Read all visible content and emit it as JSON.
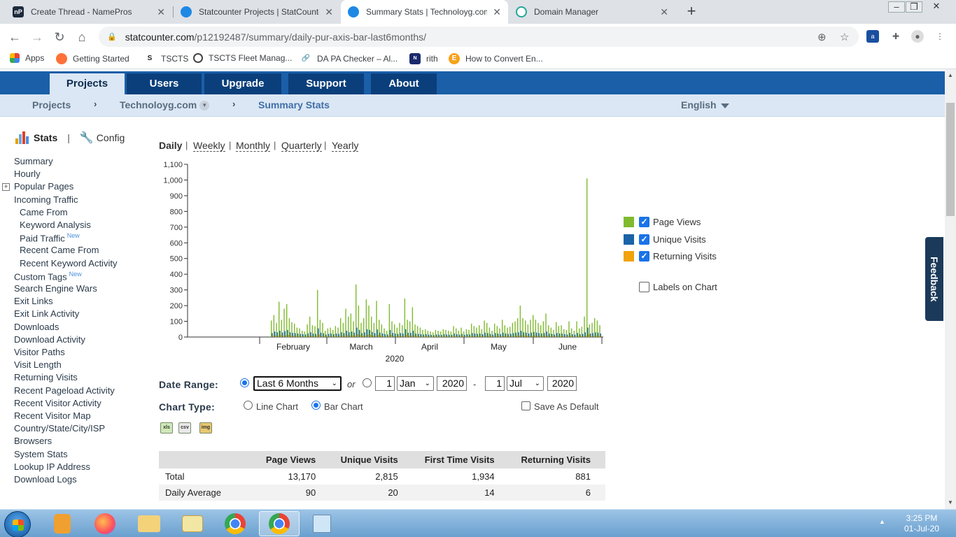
{
  "browser": {
    "tabs": [
      {
        "title": "Create Thread - NamePros",
        "favicon": "nP",
        "color": "#1c2a3c"
      },
      {
        "title": "Statcounter Projects | StatCounte",
        "favicon": "sc",
        "color": "#1e88e5"
      },
      {
        "title": "Summary Stats | Technoloyg.com",
        "favicon": "sc",
        "color": "#1e88e5"
      },
      {
        "title": "Domain Manager",
        "favicon": "dm",
        "color": "#26a69a"
      }
    ],
    "url_host": "statcounter.com",
    "url_path": "/p12192487/summary/daily-pur-axis-bar-last6months/",
    "bookmarks": [
      "Apps",
      "Getting Started",
      "TSCTS",
      "TSCTS Fleet Manag...",
      "DA PA Checker – Al...",
      "rith",
      "How to Convert En..."
    ]
  },
  "nav": {
    "tabs": [
      "Projects",
      "Users",
      "Upgrade",
      "Support",
      "About"
    ],
    "breadcrumb": [
      "Projects",
      "Technoloyg.com",
      "Summary Stats"
    ],
    "language": "English"
  },
  "sidebar": {
    "stats": "Stats",
    "config": "Config",
    "items": [
      {
        "label": "Summary",
        "indent": false,
        "tag": ""
      },
      {
        "label": "Hourly",
        "indent": false,
        "tag": ""
      },
      {
        "label": "Popular Pages",
        "indent": false,
        "tag": "",
        "expand": true
      },
      {
        "label": "Incoming Traffic",
        "indent": false,
        "tag": ""
      },
      {
        "label": "Came From",
        "indent": true,
        "tag": ""
      },
      {
        "label": "Keyword Analysis",
        "indent": true,
        "tag": ""
      },
      {
        "label": "Paid Traffic",
        "indent": true,
        "tag": "New"
      },
      {
        "label": "Recent Came From",
        "indent": true,
        "tag": ""
      },
      {
        "label": "Recent Keyword Activity",
        "indent": true,
        "tag": ""
      },
      {
        "label": "Custom Tags",
        "indent": false,
        "tag": "New"
      },
      {
        "label": "Search Engine Wars",
        "indent": false,
        "tag": ""
      },
      {
        "label": "Exit Links",
        "indent": false,
        "tag": ""
      },
      {
        "label": "Exit Link Activity",
        "indent": false,
        "tag": ""
      },
      {
        "label": "Downloads",
        "indent": false,
        "tag": ""
      },
      {
        "label": "Download Activity",
        "indent": false,
        "tag": ""
      },
      {
        "label": "Visitor Paths",
        "indent": false,
        "tag": ""
      },
      {
        "label": "Visit Length",
        "indent": false,
        "tag": ""
      },
      {
        "label": "Returning Visits",
        "indent": false,
        "tag": ""
      },
      {
        "label": "Recent Pageload Activity",
        "indent": false,
        "tag": ""
      },
      {
        "label": "Recent Visitor Activity",
        "indent": false,
        "tag": ""
      },
      {
        "label": "Recent Visitor Map",
        "indent": false,
        "tag": ""
      },
      {
        "label": "Country/State/City/ISP",
        "indent": false,
        "tag": ""
      },
      {
        "label": "Browsers",
        "indent": false,
        "tag": ""
      },
      {
        "label": "System Stats",
        "indent": false,
        "tag": ""
      },
      {
        "label": "Lookup IP Address",
        "indent": false,
        "tag": ""
      },
      {
        "label": "Download Logs",
        "indent": false,
        "tag": ""
      }
    ]
  },
  "periods": {
    "daily": "Daily",
    "weekly": "Weekly",
    "monthly": "Monthly",
    "quarterly": "Quarterly",
    "yearly": "Yearly"
  },
  "legend": {
    "page_views": "Page Views",
    "unique_visits": "Unique Visits",
    "returning_visits": "Returning Visits",
    "labels_on_chart": "Labels on Chart",
    "colors": {
      "page_views": "#7fba2f",
      "unique_visits": "#1a63a8",
      "returning_visits": "#f0a30a"
    }
  },
  "controls": {
    "date_range_label": "Date Range:",
    "range_value": "Last 6 Months",
    "or": "or",
    "from_day": "1",
    "from_month": "Jan",
    "from_year": "2020",
    "dash": "-",
    "to_day": "1",
    "to_month": "Jul",
    "to_year": "2020",
    "chart_type_label": "Chart Type:",
    "line_chart": "Line Chart",
    "bar_chart": "Bar Chart",
    "save_default": "Save As Default",
    "exports": [
      "xls",
      "csv",
      "img"
    ]
  },
  "table": {
    "headers": [
      "",
      "Page Views",
      "Unique Visits",
      "First Time Visits",
      "Returning Visits"
    ],
    "rows": [
      [
        "Total",
        "13,170",
        "2,815",
        "1,934",
        "881"
      ],
      [
        "Daily Average",
        "90",
        "20",
        "14",
        "6"
      ]
    ]
  },
  "feedback": "Feedback",
  "taskbar": {
    "time": "3:25 PM",
    "date": "01-Jul-20"
  },
  "chart_data": {
    "type": "bar",
    "ylim": [
      0,
      1100
    ],
    "yticks": [
      "0",
      "100",
      "200",
      "300",
      "400",
      "500",
      "600",
      "700",
      "800",
      "900",
      "1,000",
      "1,100"
    ],
    "month_labels": [
      "February",
      "March",
      "April",
      "May",
      "June"
    ],
    "year_label": "2020",
    "series": [
      {
        "name": "Page Views",
        "color": "#7fba2f",
        "values": [
          105,
          140,
          90,
          225,
          110,
          180,
          210,
          120,
          95,
          85,
          60,
          55,
          40,
          35,
          80,
          130,
          75,
          70,
          300,
          110,
          90,
          40,
          55,
          60,
          45,
          70,
          60,
          120,
          90,
          180,
          130,
          150,
          100,
          335,
          200,
          90,
          120,
          240,
          200,
          130,
          90,
          230,
          110,
          80,
          55,
          40,
          210,
          100,
          80,
          60,
          90,
          75,
          245,
          110,
          100,
          190,
          80,
          70,
          60,
          45,
          50,
          40,
          35,
          30,
          45,
          40,
          35,
          50,
          45,
          40,
          35,
          70,
          55,
          40,
          60,
          35,
          50,
          45,
          85,
          70,
          60,
          75,
          50,
          105,
          90,
          60,
          40,
          85,
          70,
          55,
          110,
          75,
          60,
          65,
          90,
          100,
          120,
          200,
          120,
          105,
          80,
          110,
          140,
          110,
          90,
          75,
          100,
          150,
          75,
          60,
          45,
          95,
          70,
          75,
          50,
          45,
          100,
          55,
          40,
          100,
          55,
          65,
          130,
          1010,
          80,
          90,
          120,
          105,
          75
        ]
      },
      {
        "name": "Unique Visits",
        "color": "#1a63a8",
        "values": [
          25,
          35,
          30,
          40,
          28,
          38,
          45,
          30,
          26,
          25,
          22,
          20,
          18,
          16,
          24,
          30,
          22,
          20,
          55,
          28,
          24,
          16,
          20,
          22,
          18,
          22,
          20,
          30,
          25,
          40,
          30,
          35,
          28,
          60,
          45,
          25,
          30,
          50,
          45,
          32,
          25,
          48,
          28,
          22,
          18,
          16,
          45,
          26,
          22,
          20,
          25,
          22,
          50,
          28,
          26,
          40,
          22,
          20,
          18,
          16,
          18,
          15,
          14,
          12,
          16,
          15,
          14,
          18,
          16,
          15,
          14,
          22,
          18,
          15,
          20,
          14,
          18,
          16,
          25,
          22,
          20,
          22,
          18,
          28,
          25,
          20,
          15,
          25,
          22,
          18,
          28,
          22,
          20,
          20,
          25,
          28,
          30,
          40,
          30,
          28,
          22,
          28,
          32,
          28,
          25,
          22,
          26,
          35,
          22,
          20,
          16,
          26,
          22,
          22,
          18,
          16,
          26,
          18,
          15,
          26,
          18,
          20,
          30,
          60,
          22,
          25,
          30,
          28,
          22
        ]
      },
      {
        "name": "Returning Visits",
        "color": "#f0a30a",
        "values": [
          8,
          10,
          9,
          12,
          8,
          11,
          13,
          9,
          8,
          7,
          6,
          6,
          5,
          5,
          7,
          9,
          7,
          6,
          16,
          8,
          7,
          5,
          6,
          6,
          5,
          6,
          6,
          9,
          7,
          12,
          9,
          10,
          8,
          18,
          13,
          7,
          9,
          15,
          13,
          9,
          7,
          14,
          8,
          6,
          5,
          5,
          13,
          8,
          6,
          6,
          7,
          6,
          15,
          8,
          8,
          12,
          6,
          6,
          5,
          5,
          5,
          4,
          4,
          3,
          5,
          4,
          4,
          5,
          5,
          4,
          4,
          6,
          5,
          4,
          6,
          4,
          5,
          5,
          7,
          6,
          6,
          6,
          5,
          8,
          7,
          6,
          4,
          7,
          6,
          5,
          8,
          6,
          6,
          6,
          7,
          8,
          9,
          12,
          9,
          8,
          6,
          8,
          9,
          8,
          7,
          6,
          8,
          10,
          6,
          6,
          5,
          8,
          6,
          6,
          5,
          5,
          8,
          5,
          4,
          8,
          5,
          6,
          9,
          18,
          6,
          7,
          9,
          8,
          6
        ]
      }
    ]
  }
}
